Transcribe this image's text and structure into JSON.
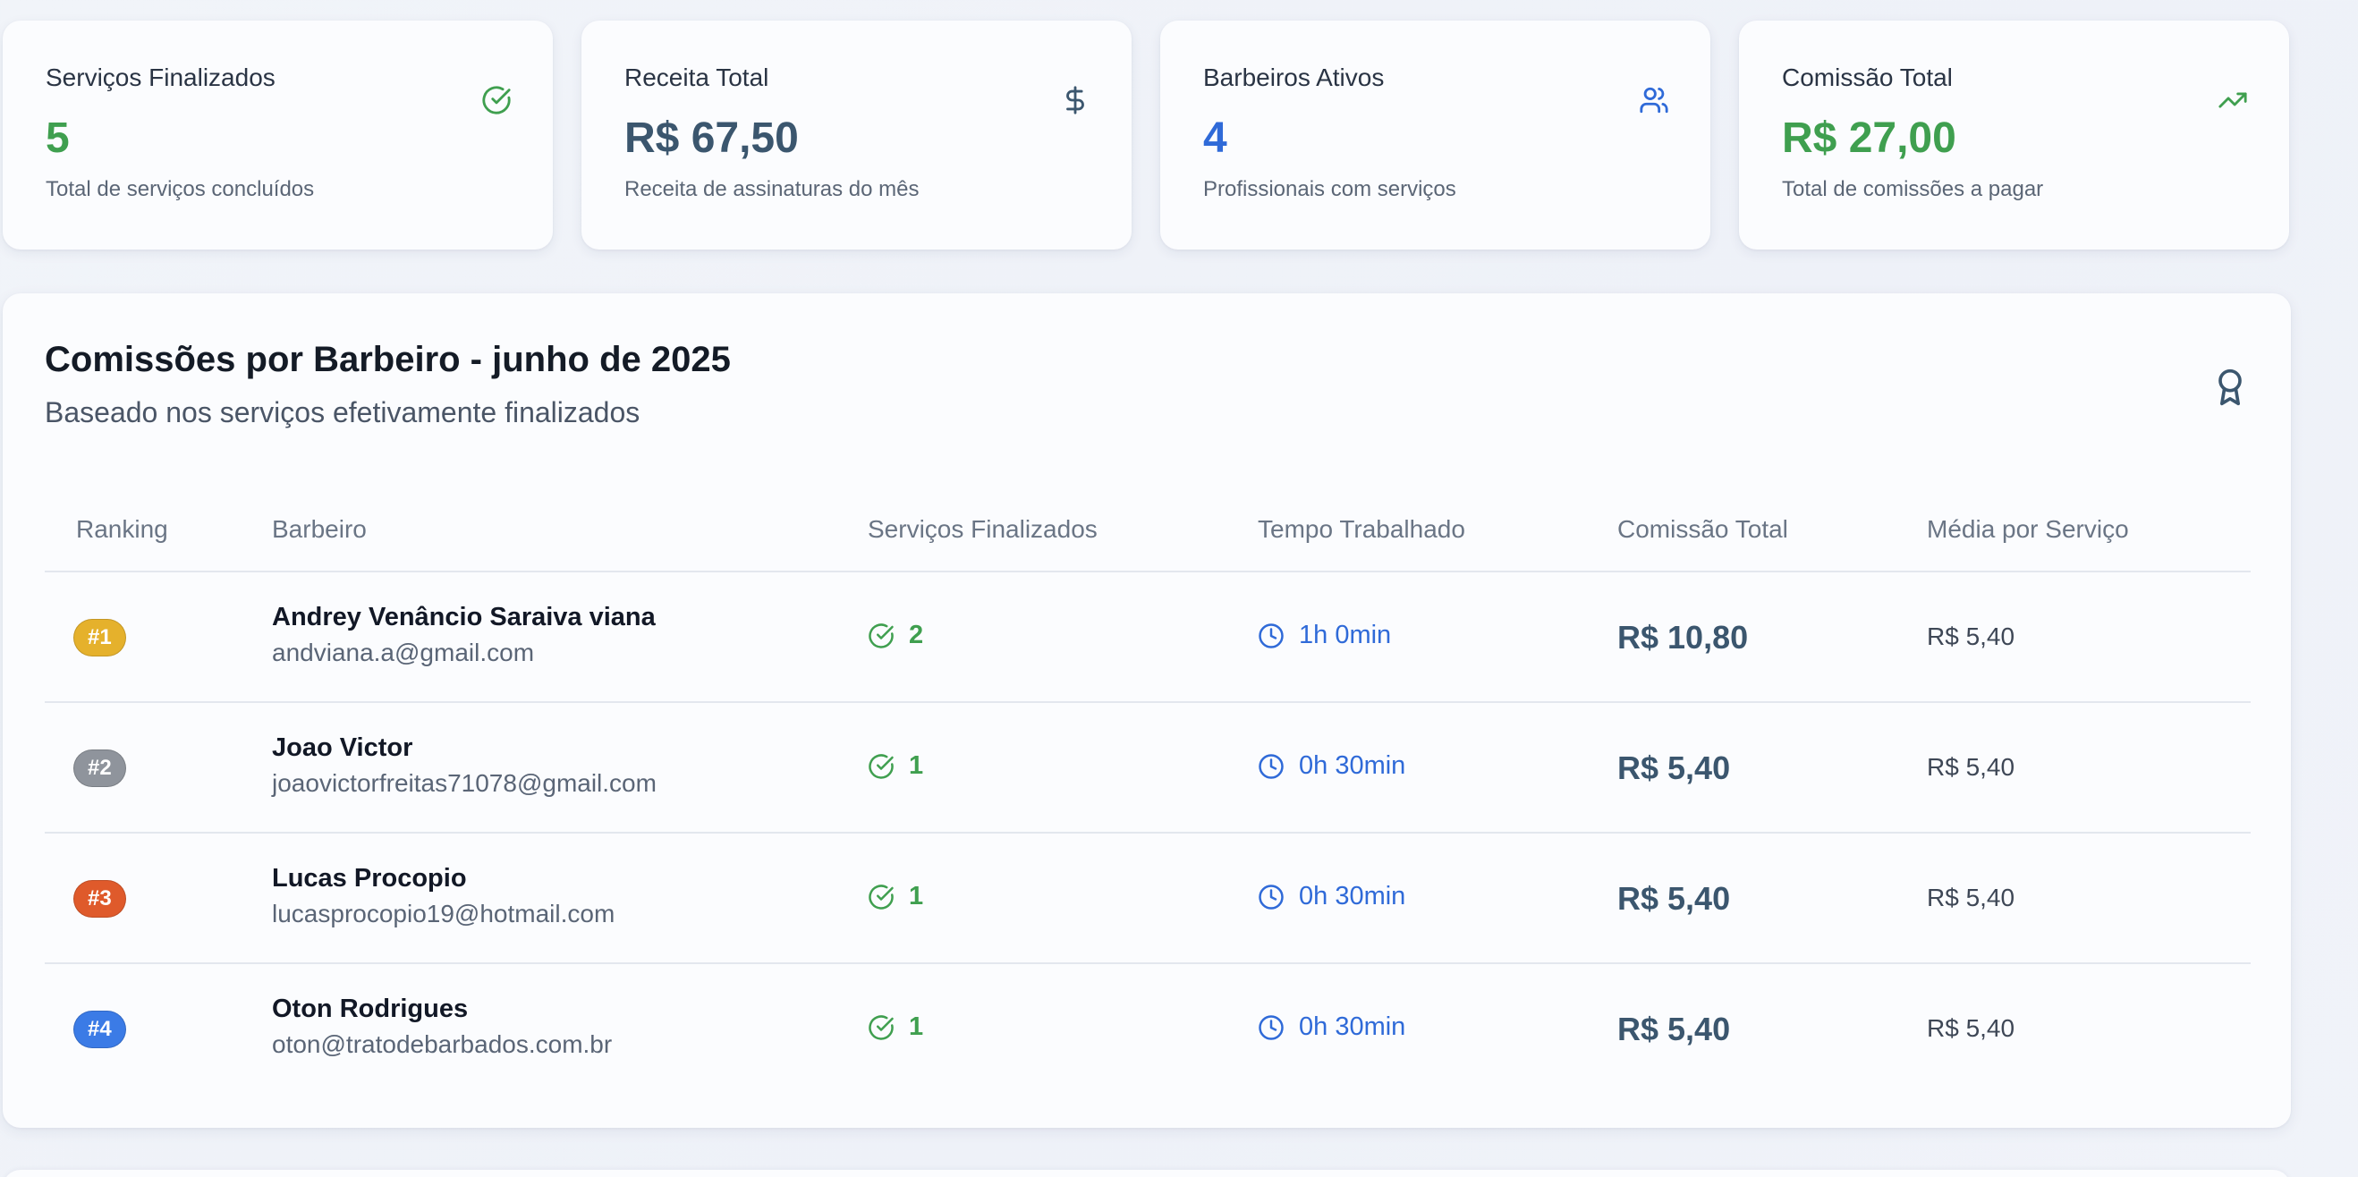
{
  "stats": [
    {
      "label": "Serviços Finalizados",
      "value": "5",
      "desc": "Total de serviços concluídos",
      "icon": "check-circle-icon",
      "color": "#3f9f4f"
    },
    {
      "label": "Receita Total",
      "value": "R$ 67,50",
      "desc": "Receita de assinaturas do mês",
      "icon": "dollar-icon",
      "color": "#3b566e"
    },
    {
      "label": "Barbeiros Ativos",
      "value": "4",
      "desc": "Profissionais com serviços",
      "icon": "users-icon",
      "color": "#2f6ad8"
    },
    {
      "label": "Comissão Total",
      "value": "R$ 27,00",
      "desc": "Total de comissões a pagar",
      "icon": "trending-up-icon",
      "color": "#3f9f4f"
    }
  ],
  "panel": {
    "title": "Comissões por Barbeiro - junho de 2025",
    "subtitle": "Baseado nos serviços efetivamente finalizados",
    "icon": "award-icon"
  },
  "table": {
    "headers": [
      "Ranking",
      "Barbeiro",
      "Serviços Finalizados",
      "Tempo Trabalhado",
      "Comissão Total",
      "Média por Serviço"
    ],
    "rows": [
      {
        "rank": "#1",
        "rank_color": "#e5b12c",
        "name": "Andrey Venâncio Saraiva viana",
        "email": "andviana.a@gmail.com",
        "services": "2",
        "time": "1h 0min",
        "commission": "R$ 10,80",
        "average": "R$ 5,40"
      },
      {
        "rank": "#2",
        "rank_color": "#8f949c",
        "name": "Joao Victor",
        "email": "joaovictorfreitas71078@gmail.com",
        "services": "1",
        "time": "0h 30min",
        "commission": "R$ 5,40",
        "average": "R$ 5,40"
      },
      {
        "rank": "#3",
        "rank_color": "#df5a2b",
        "name": "Lucas Procopio",
        "email": "lucasprocopio19@hotmail.com",
        "services": "1",
        "time": "0h 30min",
        "commission": "R$ 5,40",
        "average": "R$ 5,40"
      },
      {
        "rank": "#4",
        "rank_color": "#3b7be6",
        "name": "Oton Rodrigues",
        "email": "oton@tratodebarbados.com.br",
        "services": "1",
        "time": "0h 30min",
        "commission": "R$ 5,40",
        "average": "R$ 5,40"
      }
    ]
  }
}
